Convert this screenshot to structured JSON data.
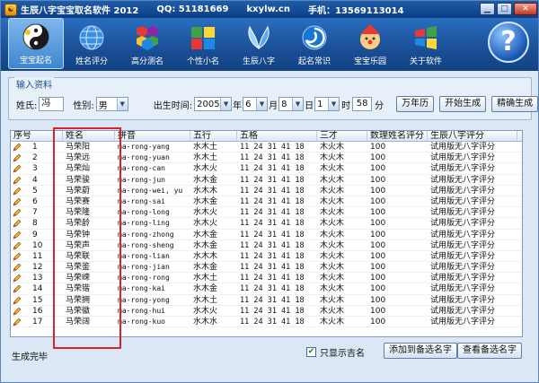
{
  "titlebar": {
    "title": "生辰八字宝宝取名软件 2012",
    "qq": "QQ: 51181669",
    "site": "kxylw.cn",
    "phone": "手机：13569113014"
  },
  "toolbar": [
    {
      "label": "宝宝起名",
      "icon": "yin-yang-icon",
      "active": true
    },
    {
      "label": "姓名评分",
      "icon": "globe-icon"
    },
    {
      "label": "高分测名",
      "icon": "hexagon-cluster-icon"
    },
    {
      "label": "个性小名",
      "icon": "colorful-blocks-icon"
    },
    {
      "label": "生辰八字",
      "icon": "wings-icon"
    },
    {
      "label": "起名常识",
      "icon": "swirl-icon"
    },
    {
      "label": "宝宝乐园",
      "icon": "clown-icon"
    },
    {
      "label": "关于软件",
      "icon": "windows-flag-icon"
    }
  ],
  "help_label": "?",
  "input": {
    "legend": "输入资料",
    "surname_label": "姓氏:",
    "surname_value": "冯",
    "gender_label": "性别:",
    "gender_value": "男",
    "birth_label": "出生时间:",
    "year": "2005",
    "year_unit": "年",
    "month": "6",
    "month_unit": "月",
    "day": "8",
    "day_unit": "日",
    "hour": "1",
    "hour_unit": "时",
    "minute": "58",
    "minute_unit": "分",
    "calendar_button": "万年历",
    "start_button": "开始生成",
    "precise_button": "精确生成"
  },
  "table": {
    "headers": [
      "序号",
      "姓名",
      "拼音",
      "五行",
      "五格",
      "三才",
      "数理姓名评分",
      "生辰八字评分"
    ],
    "rows": [
      [
        "1",
        "马荣阳",
        "ma-rong-yang",
        "水木土",
        "11 24 31 41 18",
        "木火木",
        "100",
        "试用版无八字评分"
      ],
      [
        "2",
        "马荣远",
        "ma-rong-yuan",
        "水木土",
        "11 24 31 41 18",
        "木火木",
        "100",
        "试用版无八字评分"
      ],
      [
        "3",
        "马荣灿",
        "ma-rong-can",
        "水木火",
        "11 24 31 41 18",
        "木火木",
        "100",
        "试用版无八字评分"
      ],
      [
        "4",
        "马荣骏",
        "ma-rong-jun",
        "水木金",
        "11 24 31 41 18",
        "木火木",
        "100",
        "试用版无八字评分"
      ],
      [
        "5",
        "马荣蔚",
        "ma-rong-wei, yu",
        "水木木",
        "11 24 31 41 18",
        "木火木",
        "100",
        "试用版无八字评分"
      ],
      [
        "6",
        "马荣赛",
        "ma-rong-sai",
        "水木金",
        "11 24 31 41 18",
        "木火木",
        "100",
        "试用版无八字评分"
      ],
      [
        "7",
        "马荣隆",
        "ma-rong-long",
        "水木火",
        "11 24 31 41 18",
        "木火木",
        "100",
        "试用版无八字评分"
      ],
      [
        "8",
        "马荣龄",
        "ma-rong-ling",
        "水木火",
        "11 24 31 41 18",
        "木火木",
        "100",
        "试用版无八字评分"
      ],
      [
        "9",
        "马荣钟",
        "ma-rong-zhong",
        "水木金",
        "11 24 31 41 18",
        "木火木",
        "100",
        "试用版无八字评分"
      ],
      [
        "10",
        "马荣声",
        "ma-rong-sheng",
        "水木金",
        "11 24 31 41 18",
        "木火木",
        "100",
        "试用版无八字评分"
      ],
      [
        "11",
        "马荣联",
        "ma-rong-lian",
        "水木木",
        "11 24 31 41 18",
        "木火木",
        "100",
        "试用版无八字评分"
      ],
      [
        "12",
        "马荣鉴",
        "ma-rong-jian",
        "水木金",
        "11 24 31 41 18",
        "木火木",
        "100",
        "试用版无八字评分"
      ],
      [
        "13",
        "马荣嵘",
        "ma-rong-rong",
        "水木土",
        "11 24 31 41 18",
        "木火木",
        "100",
        "试用版无八字评分"
      ],
      [
        "14",
        "马荣锴",
        "ma-rong-kai",
        "水木金",
        "11 24 31 41 18",
        "木火木",
        "100",
        "试用版无八字评分"
      ],
      [
        "15",
        "马荣拥",
        "ma-rong-yong",
        "水木土",
        "11 24 31 41 18",
        "木火木",
        "100",
        "试用版无八字评分"
      ],
      [
        "16",
        "马荣徽",
        "ma-rong-hui",
        "水木火",
        "11 24 31 41 18",
        "木火木",
        "100",
        "试用版无八字评分"
      ],
      [
        "17",
        "马荣阔",
        "ma-rong-kuo",
        "水木水",
        "11 24 31 41 18",
        "木火木",
        "100",
        "试用版无八字评分"
      ]
    ]
  },
  "status": {
    "text": "生成完毕",
    "checkbox_label": "只显示吉名",
    "checkbox_checked": true,
    "add_button": "添加到备选名字",
    "view_button": "查看备选名字"
  }
}
